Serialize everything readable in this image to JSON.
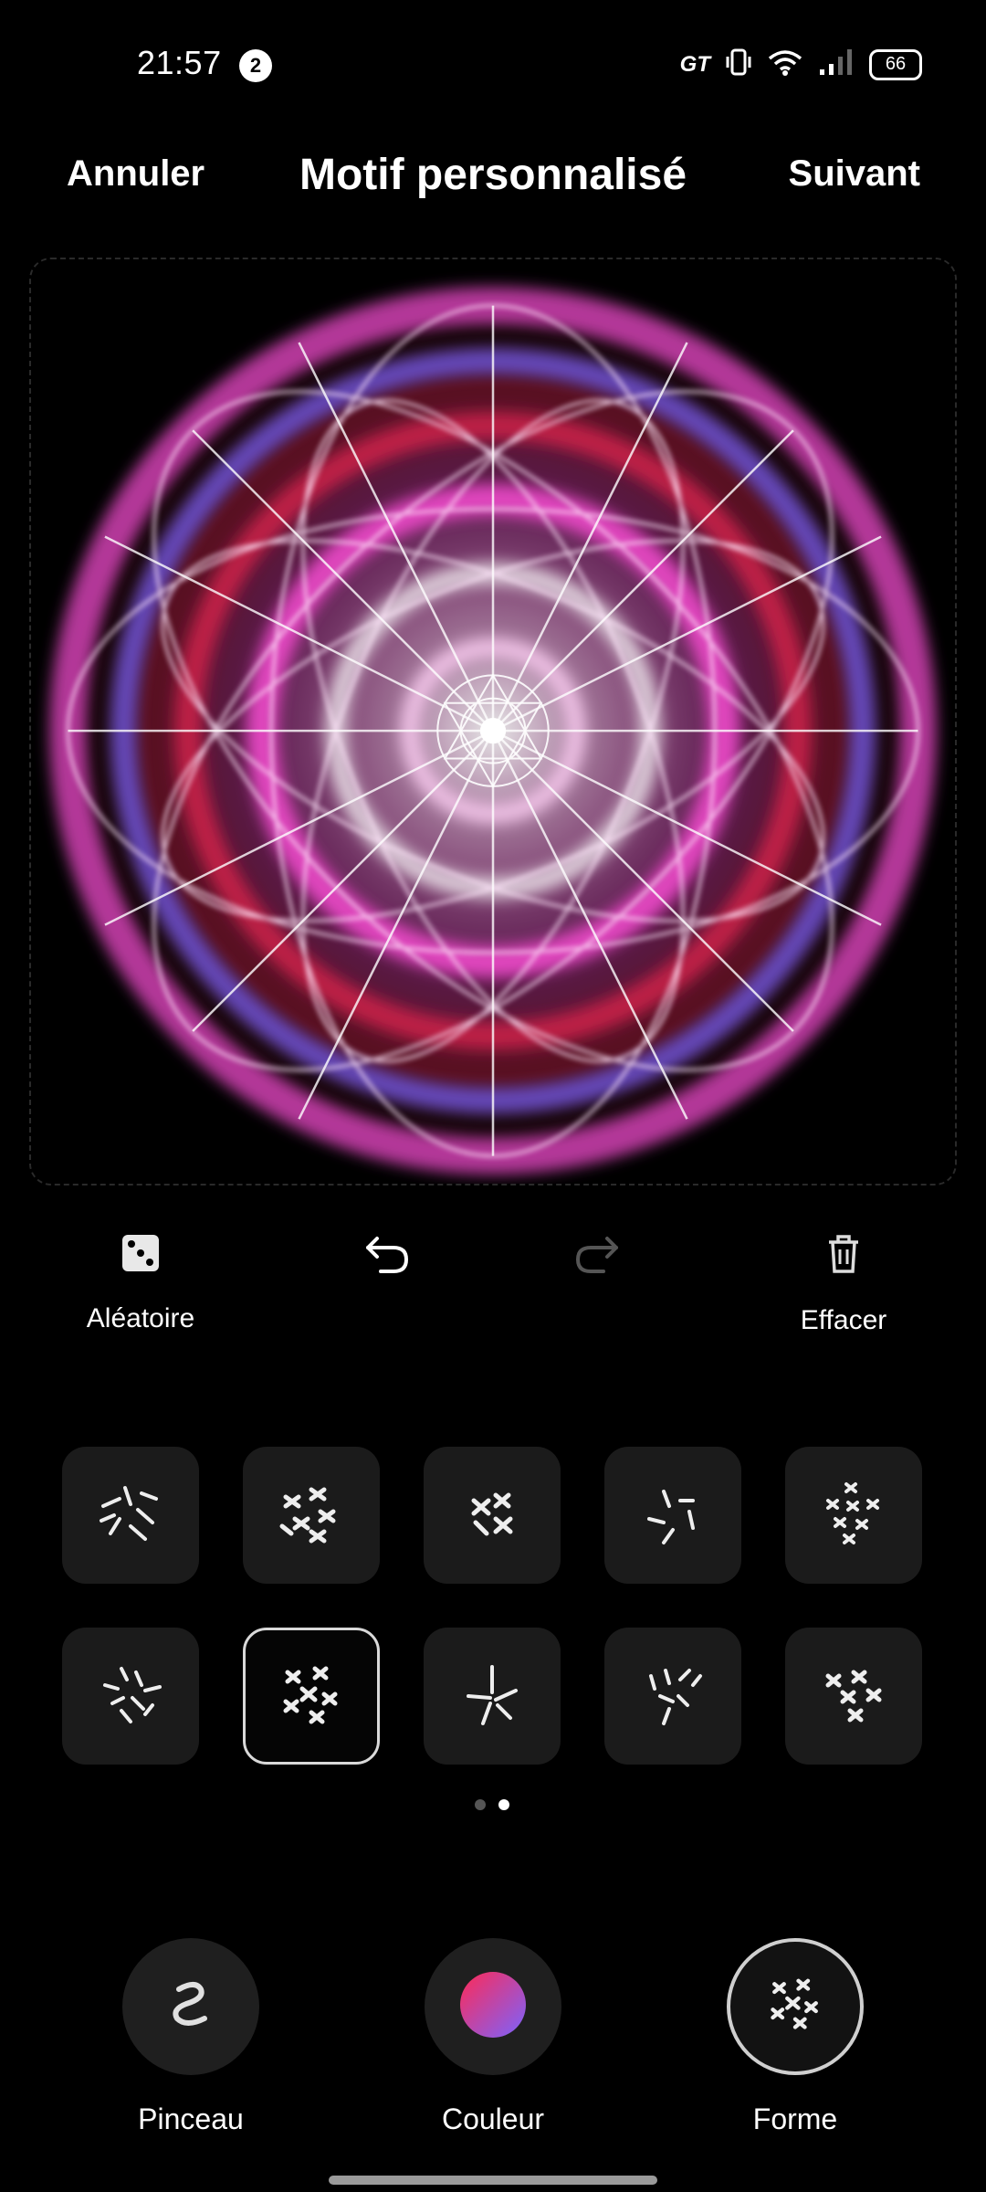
{
  "status_bar": {
    "time": "21:57",
    "notification_count": "2",
    "network_label": "GT",
    "battery": "66"
  },
  "header": {
    "cancel_label": "Annuler",
    "title": "Motif personnalisé",
    "next_label": "Suivant"
  },
  "toolbar": {
    "random_label": "Aléatoire",
    "clear_label": "Effacer"
  },
  "shapes": {
    "items": [
      "shape-1",
      "shape-2",
      "shape-3",
      "shape-4",
      "shape-5",
      "shape-6",
      "shape-7",
      "shape-8",
      "shape-9",
      "shape-10"
    ],
    "selected_index": 6,
    "page_count": 2,
    "current_page": 2
  },
  "bottom_nav": {
    "brush_label": "Pinceau",
    "color_label": "Couleur",
    "shape_label": "Forme",
    "active": "Forme"
  },
  "colors": {
    "pink": "#ff4fd8",
    "red": "#ff2a55",
    "blue": "#7a63ff",
    "white": "#ffffff"
  }
}
